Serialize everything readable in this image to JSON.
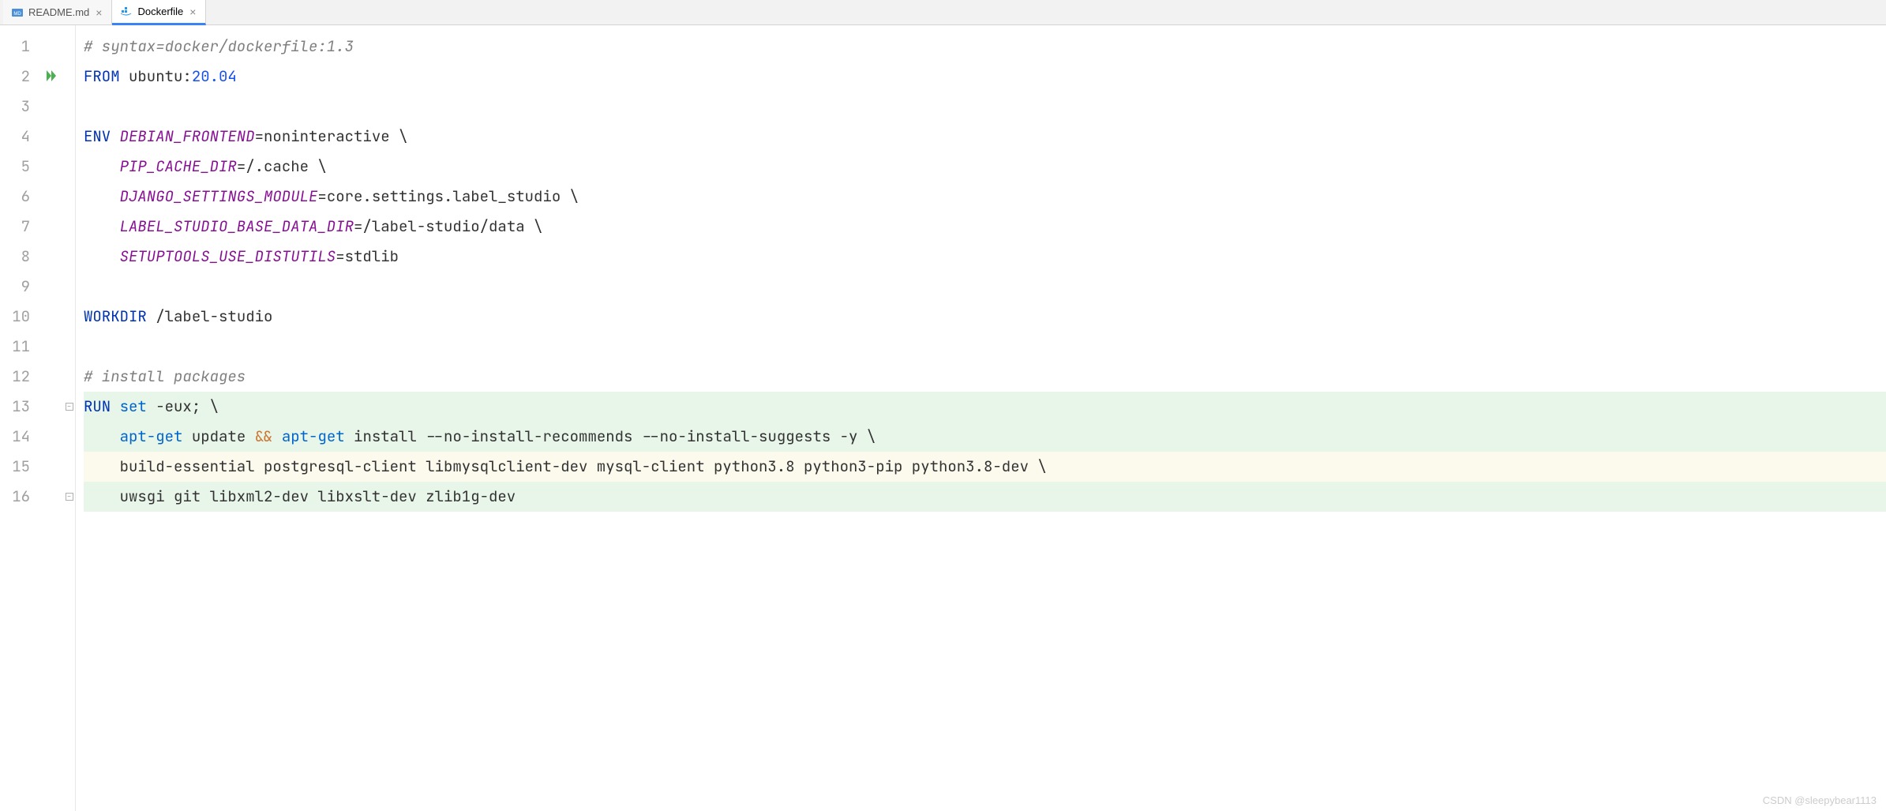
{
  "tabs": [
    {
      "name": "README.md",
      "icon": "md-icon",
      "active": false
    },
    {
      "name": "Dockerfile",
      "icon": "docker-icon",
      "active": true
    }
  ],
  "gutter": {
    "lines": [
      "1",
      "2",
      "3",
      "4",
      "5",
      "6",
      "7",
      "8",
      "9",
      "10",
      "11",
      "12",
      "13",
      "14",
      "15",
      "16"
    ],
    "run_marker_line": 2,
    "fold_markers": [
      13,
      16
    ]
  },
  "code": {
    "lines": [
      {
        "n": 1,
        "segments": [
          {
            "cls": "tok-comment",
            "t": "# syntax=docker/dockerfile:1.3"
          }
        ]
      },
      {
        "n": 2,
        "segments": [
          {
            "cls": "tok-from",
            "t": "FROM"
          },
          {
            "cls": "",
            "t": " ubuntu:"
          },
          {
            "cls": "tok-number",
            "t": "20.04"
          }
        ]
      },
      {
        "n": 3,
        "segments": []
      },
      {
        "n": 4,
        "segments": [
          {
            "cls": "tok-from",
            "t": "ENV"
          },
          {
            "cls": "",
            "t": " "
          },
          {
            "cls": "tok-env-var",
            "t": "DEBIAN_FRONTEND"
          },
          {
            "cls": "",
            "t": "=noninteractive \\"
          }
        ]
      },
      {
        "n": 5,
        "segments": [
          {
            "cls": "",
            "t": "    "
          },
          {
            "cls": "tok-env-var",
            "t": "PIP_CACHE_DIR"
          },
          {
            "cls": "",
            "t": "=/.cache \\"
          }
        ]
      },
      {
        "n": 6,
        "segments": [
          {
            "cls": "",
            "t": "    "
          },
          {
            "cls": "tok-env-var",
            "t": "DJANGO_SETTINGS_MODULE"
          },
          {
            "cls": "",
            "t": "=core.settings.label_studio \\"
          }
        ]
      },
      {
        "n": 7,
        "segments": [
          {
            "cls": "",
            "t": "    "
          },
          {
            "cls": "tok-env-var",
            "t": "LABEL_STUDIO_BASE_DATA_DIR"
          },
          {
            "cls": "",
            "t": "=/label-studio/data \\"
          }
        ]
      },
      {
        "n": 8,
        "segments": [
          {
            "cls": "",
            "t": "    "
          },
          {
            "cls": "tok-env-var",
            "t": "SETUPTOOLS_USE_DISTUTILS"
          },
          {
            "cls": "",
            "t": "=stdlib"
          }
        ]
      },
      {
        "n": 9,
        "segments": []
      },
      {
        "n": 10,
        "segments": [
          {
            "cls": "tok-from",
            "t": "WORKDIR"
          },
          {
            "cls": "",
            "t": " /label-studio"
          }
        ]
      },
      {
        "n": 11,
        "segments": []
      },
      {
        "n": 12,
        "segments": [
          {
            "cls": "tok-comment",
            "t": "# install packages"
          }
        ]
      },
      {
        "n": 13,
        "hl": true,
        "segments": [
          {
            "cls": "tok-from",
            "t": "RUN"
          },
          {
            "cls": "",
            "t": " "
          },
          {
            "cls": "tok-cmd",
            "t": "set"
          },
          {
            "cls": "",
            "t": " -eux; \\"
          }
        ]
      },
      {
        "n": 14,
        "hl": true,
        "segments": [
          {
            "cls": "",
            "t": "    "
          },
          {
            "cls": "tok-cmd",
            "t": "apt-get"
          },
          {
            "cls": "",
            "t": " update "
          },
          {
            "cls": "tok-op",
            "t": "&&"
          },
          {
            "cls": "",
            "t": " "
          },
          {
            "cls": "tok-cmd",
            "t": "apt-get"
          },
          {
            "cls": "",
            "t": " install --no-install-recommends --no-install-suggests -y \\"
          }
        ]
      },
      {
        "n": 15,
        "caret": true,
        "segments": [
          {
            "cls": "",
            "t": "    build-essential postgresql-client libmysqlclient-dev mysql-client python3.8 python3-pip python3.8-dev \\"
          }
        ]
      },
      {
        "n": 16,
        "hl": true,
        "segments": [
          {
            "cls": "",
            "t": "    uwsgi git libxml2-dev libxslt-dev zlib1g-dev"
          }
        ]
      }
    ]
  },
  "watermark": "CSDN @sleepybear1113"
}
